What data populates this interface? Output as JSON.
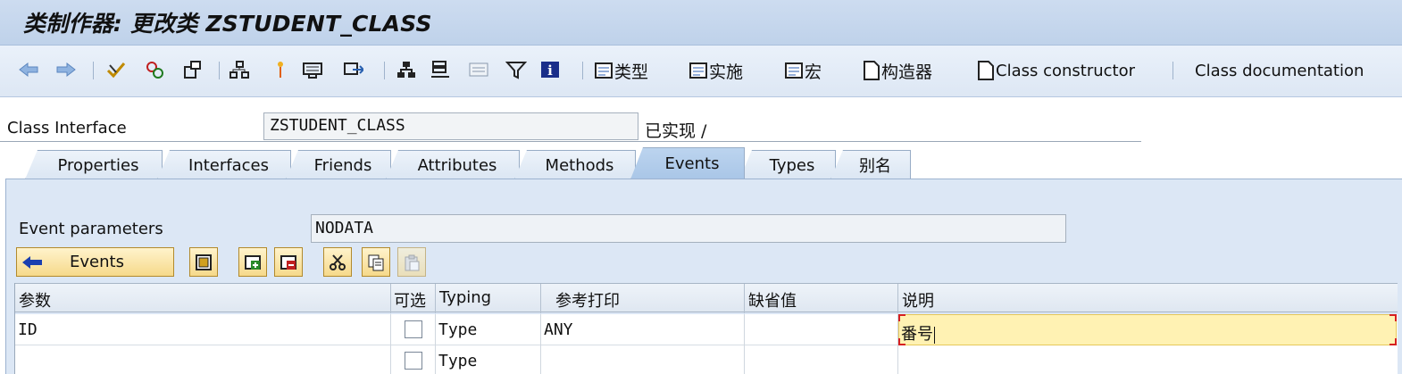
{
  "window": {
    "title": "类制作器: 更改类 ZSTUDENT_CLASS"
  },
  "toolbar": {
    "icons": [
      "back-arrow-icon",
      "forward-arrow-icon",
      "check-icon",
      "activate-icon",
      "where-used-icon",
      "hierarchy-icon",
      "pin-icon",
      "display-object-list-icon",
      "navigate-icon",
      "structure-icon",
      "tree-icon",
      "list-icon",
      "filter-icon",
      "info-icon"
    ],
    "types_label": "类型",
    "impl_label": "实施",
    "macro_label": "宏",
    "constructor_label": "构造器",
    "class_constructor_label": "Class constructor",
    "class_doc_label": "Class documentation"
  },
  "header": {
    "class_interface_label": "Class Interface",
    "class_interface_value": "ZSTUDENT_CLASS",
    "status": "已实现 /"
  },
  "tabs": [
    {
      "label": "Properties",
      "active": false
    },
    {
      "label": "Interfaces",
      "active": false
    },
    {
      "label": "Friends",
      "active": false
    },
    {
      "label": "Attributes",
      "active": false
    },
    {
      "label": "Methods",
      "active": false
    },
    {
      "label": "Events",
      "active": true
    },
    {
      "label": "Types",
      "active": false
    },
    {
      "label": "别名",
      "active": false
    }
  ],
  "event_params": {
    "label": "Event parameters",
    "value": "NODATA",
    "back_button_label": "Events"
  },
  "grid": {
    "columns": [
      "参数",
      "可选",
      "Typing",
      "参考打印",
      "缺省值",
      "说明"
    ],
    "rows": [
      {
        "param": "ID",
        "optional": false,
        "typing": "Type",
        "ref": "ANY",
        "default": "",
        "desc": "番号"
      },
      {
        "param": "",
        "optional": false,
        "typing": "Type",
        "ref": "",
        "default": "",
        "desc": ""
      }
    ]
  },
  "colors": {
    "accent": "#bcd4ef",
    "button": "#f6d98a",
    "edit_cell": "#fff2b3"
  }
}
